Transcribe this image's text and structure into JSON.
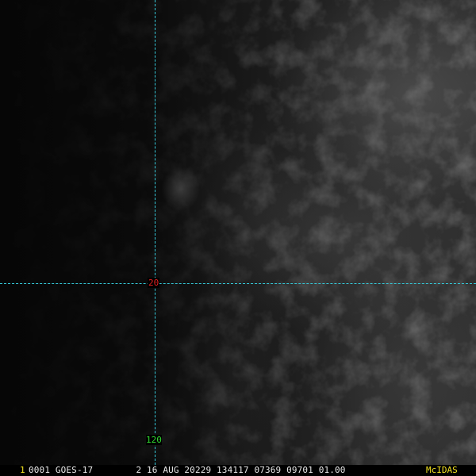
{
  "overlay": {
    "latitude_label": "20",
    "longitude_label": "120",
    "gridline_color": "#35c8d8",
    "latitude_label_color": "#e02020",
    "longitude_label_color": "#30d830"
  },
  "status_bar": {
    "frame_number": "1",
    "header_text": "0001 GOES-17        2 16 AUG 20229 134117 07369 09701 01.00",
    "brand": "McIDAS",
    "accent_color": "#f0e020"
  }
}
